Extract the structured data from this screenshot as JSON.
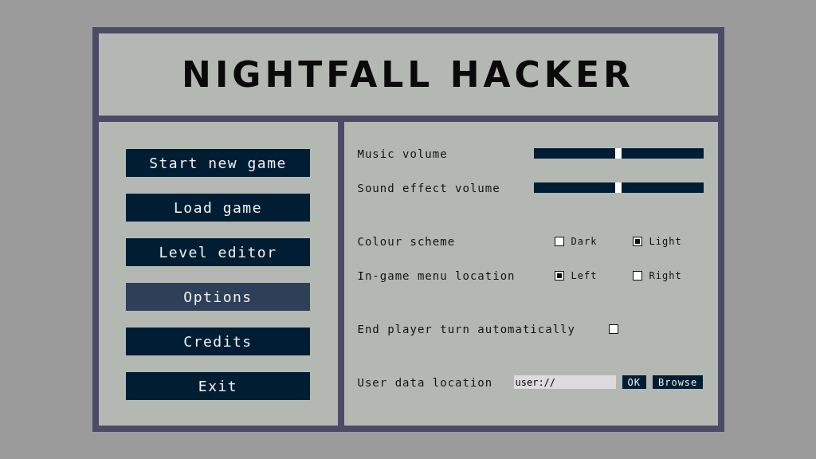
{
  "title": "NIGHTFALL HACKER",
  "menu": [
    {
      "label": "Start new game",
      "selected": false
    },
    {
      "label": "Load game",
      "selected": false
    },
    {
      "label": "Level editor",
      "selected": false
    },
    {
      "label": "Options",
      "selected": true
    },
    {
      "label": "Credits",
      "selected": false
    },
    {
      "label": "Exit",
      "selected": false
    }
  ],
  "options": [
    {
      "kind": "slider",
      "label": "Music volume",
      "level": 0.5
    },
    {
      "kind": "slider",
      "label": "Sound effect volume",
      "level": 0.5
    },
    {
      "kind": "spacer"
    },
    {
      "kind": "choice",
      "label": "Colour scheme",
      "choices": [
        {
          "label": "Dark",
          "selected": false
        },
        {
          "label": "Light",
          "selected": true
        }
      ]
    },
    {
      "kind": "choice",
      "label": "In-game menu location",
      "choices": [
        {
          "label": "Left",
          "selected": true
        },
        {
          "label": "Right",
          "selected": false
        }
      ]
    },
    {
      "kind": "spacer"
    },
    {
      "kind": "checkbox",
      "label": "End player turn automatically",
      "checked": false
    },
    {
      "kind": "spacer"
    },
    {
      "kind": "path",
      "label": "User data location",
      "value": "user://",
      "buttons": [
        "OK",
        "Browse"
      ]
    }
  ]
}
